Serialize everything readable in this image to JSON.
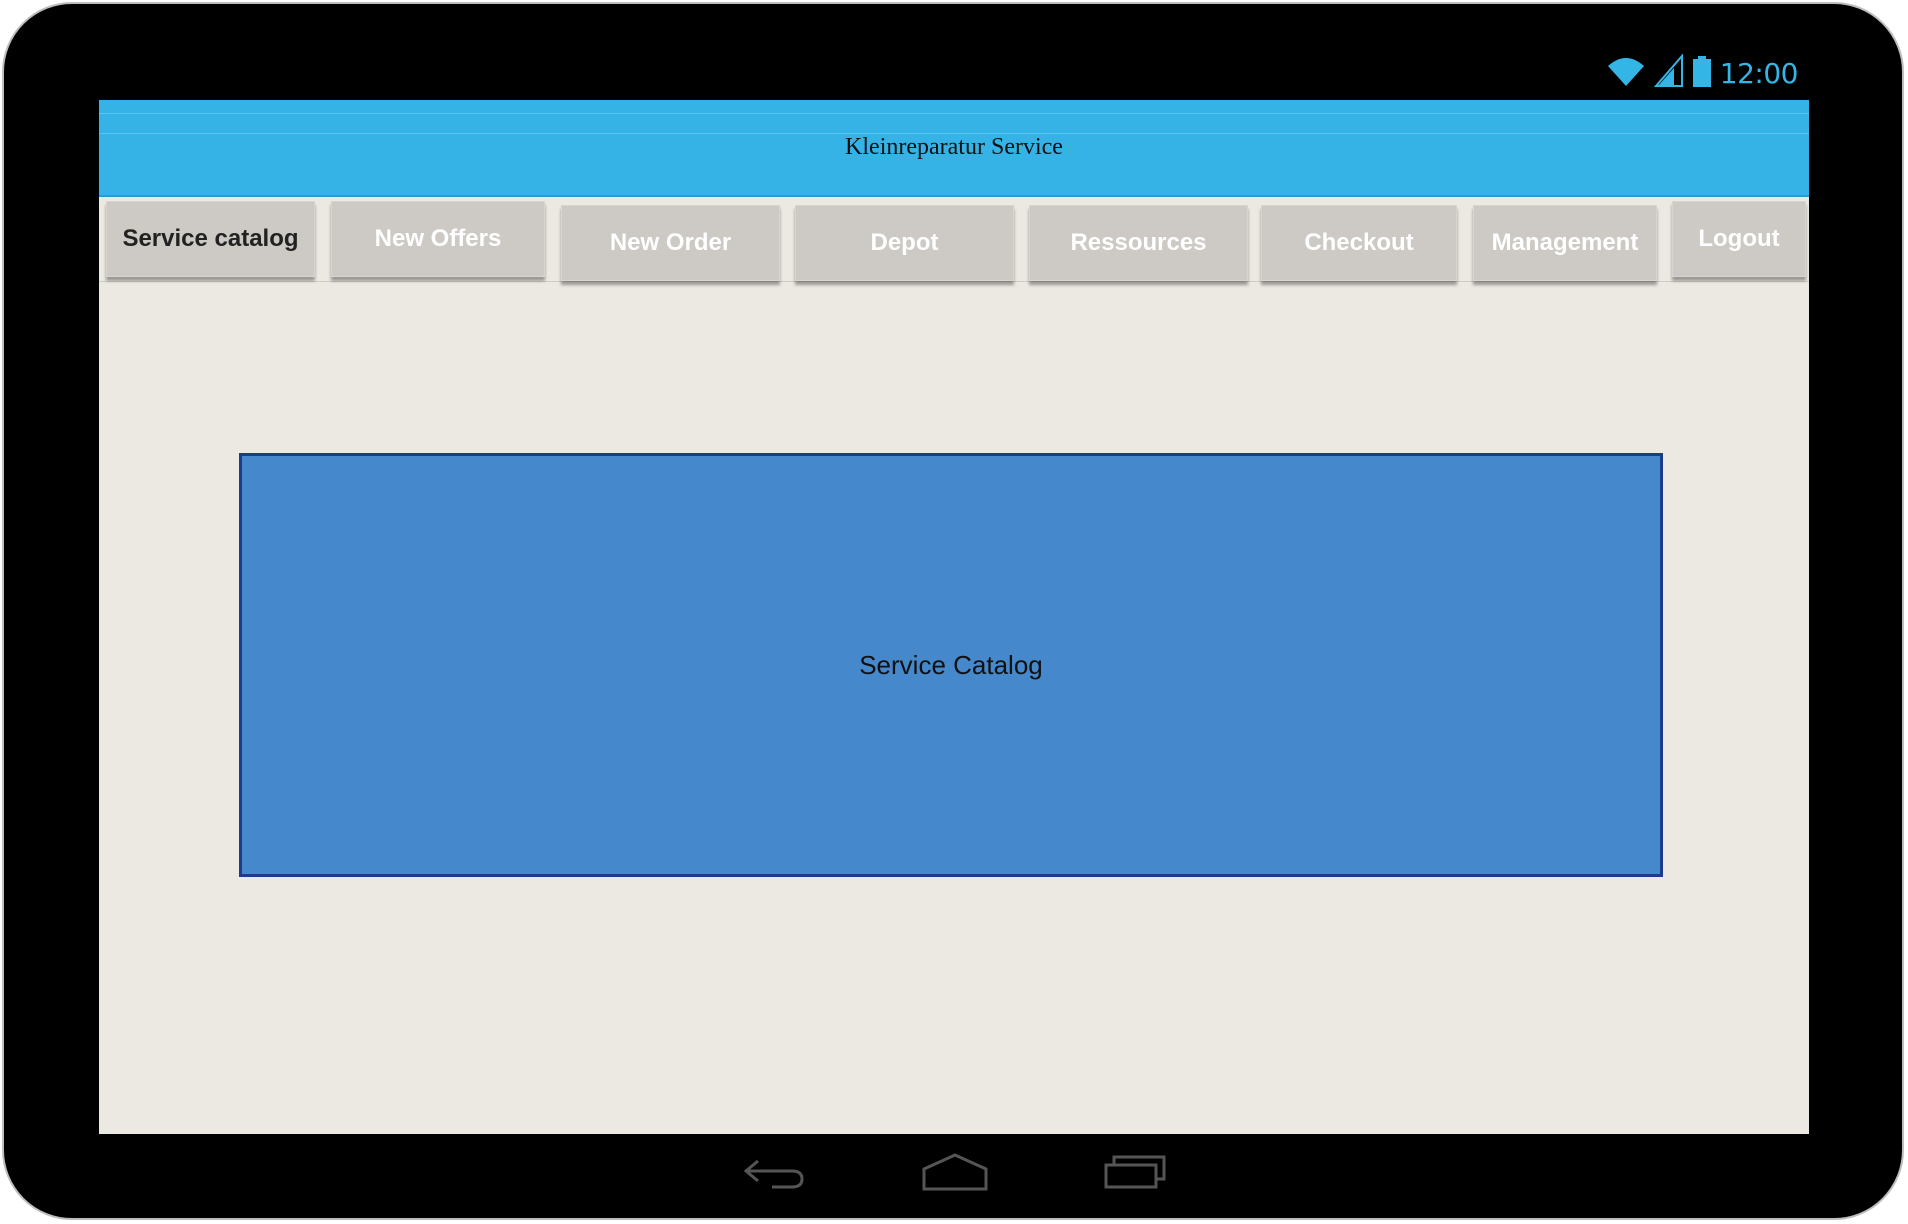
{
  "status_bar": {
    "time": "12:00",
    "icons": [
      "wifi-icon",
      "signal-icon",
      "battery-icon"
    ],
    "accent_color": "#33b5e5"
  },
  "header": {
    "title": "Kleinreparatur Service",
    "background": "#35b3e6"
  },
  "tabs": [
    {
      "label": "Service catalog",
      "active": true
    },
    {
      "label": "New Offers",
      "active": false
    },
    {
      "label": "New Order",
      "active": false
    },
    {
      "label": "Depot",
      "active": false
    },
    {
      "label": "Ressources",
      "active": false
    },
    {
      "label": "Checkout",
      "active": false
    },
    {
      "label": "Management",
      "active": false
    },
    {
      "label": "Logout",
      "active": false
    }
  ],
  "main": {
    "panel_label": "Service Catalog",
    "panel_color": "#4588cb"
  },
  "navigation": {
    "icons": [
      "back-icon",
      "home-icon",
      "recent-apps-icon"
    ]
  }
}
